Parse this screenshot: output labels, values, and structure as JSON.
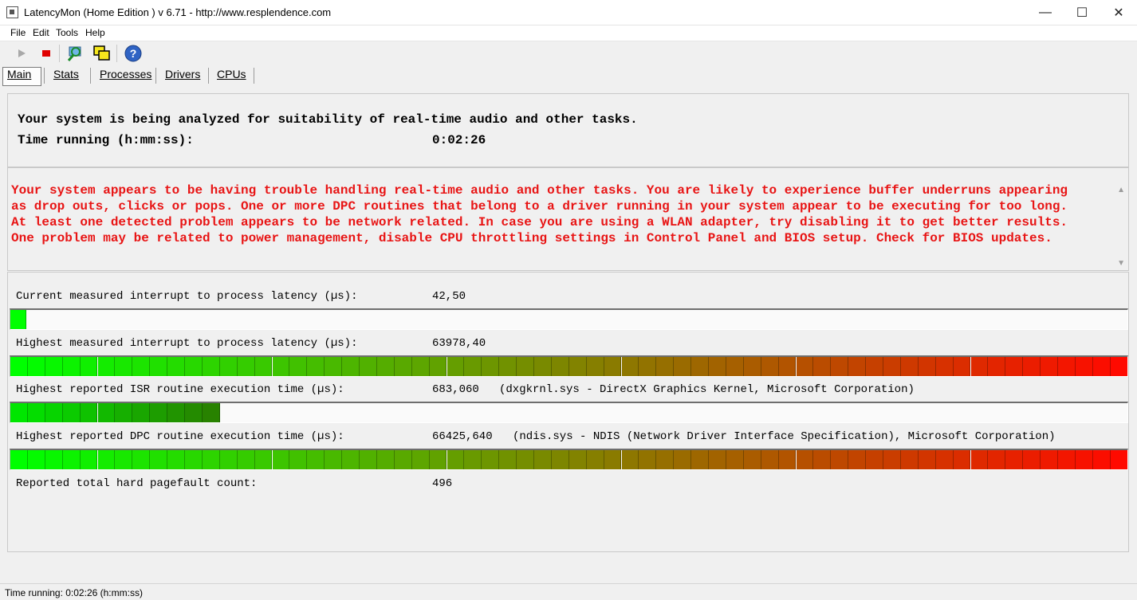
{
  "window": {
    "title": "LatencyMon  (Home Edition )  v 6.71 - http://www.resplendence.com",
    "minimize_label": "—",
    "maximize_label": "☐",
    "close_label": "✕"
  },
  "menu": [
    "File",
    "Edit",
    "Tools",
    "Help"
  ],
  "toolbar": {
    "buttons": [
      "play-icon",
      "stop-icon",
      "search-icon",
      "copy-windows-icon",
      "help-icon"
    ],
    "help_label": "?"
  },
  "tabs": [
    "Main",
    "Stats",
    "Processes",
    "Drivers",
    "CPUs"
  ],
  "status": {
    "line1": "Your system is being analyzed for suitability of real-time audio and other tasks.",
    "time_label": "Time running (h:mm:ss):",
    "time_value": "0:02:26"
  },
  "warning": {
    "color": "#e81414",
    "lines": [
      "Your system appears to be having trouble handling real-time audio and other tasks. You are likely to experience buffer underruns appearing",
      "as drop outs, clicks or pops. One or more DPC routines that belong to a driver running in your system appear to be executing for too long.",
      "At least one detected problem appears to be network related. In case you are using a WLAN adapter, try disabling it to get better results.",
      "One problem may be related to power management, disable CPU throttling settings in Control Panel and BIOS setup. Check for BIOS updates."
    ]
  },
  "measurements": [
    {
      "label": "Current measured interrupt to process latency (µs):",
      "value": "42,50",
      "extra": "",
      "level": 0.014
    },
    {
      "label": "Highest measured interrupt to process latency (µs):",
      "value": "63978,40",
      "extra": "",
      "level": 1.0
    },
    {
      "label": "Highest reported ISR routine execution time (µs):",
      "value": "683,060",
      "extra": "(dxgkrnl.sys - DirectX Graphics Kernel, Microsoft Corporation)",
      "level": 0.187
    },
    {
      "label": "Highest reported DPC routine execution time (µs):",
      "value": "66425,640",
      "extra": "(ndis.sys - NDIS (Network Driver Interface Specification), Microsoft Corporation)",
      "level": 1.0
    }
  ],
  "pagefault": {
    "label": "Reported total hard pagefault count:",
    "value": "496"
  },
  "statusbar": {
    "text": "Time running: 0:02:26  (h:mm:ss)"
  }
}
